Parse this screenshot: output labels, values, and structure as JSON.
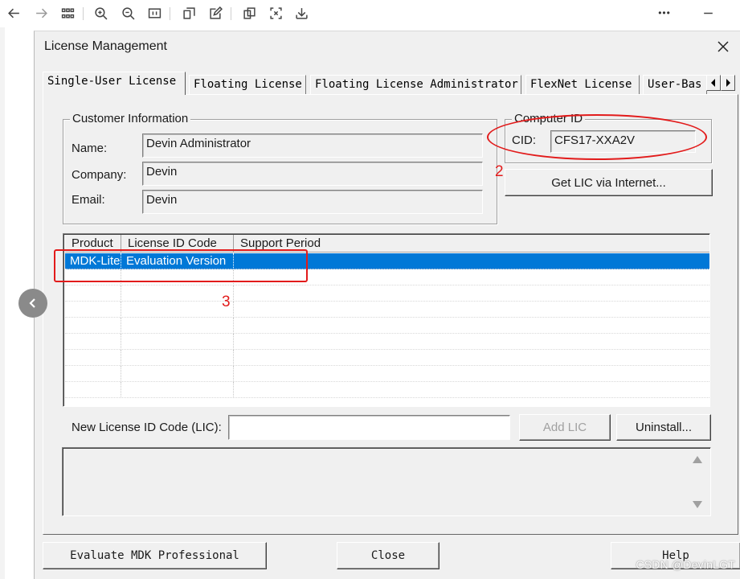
{
  "viewer": {
    "toolbar_icons": [
      "back-arrow-icon",
      "forward-arrow-icon",
      "grid-view-icon",
      "zoom-in-icon",
      "zoom-out-icon",
      "actual-size-icon",
      "crop-icon",
      "edit-icon",
      "copy-icon",
      "fullscreen-icon",
      "download-icon",
      "more-icon",
      "minimize-icon"
    ],
    "more_label": "•••"
  },
  "dialog": {
    "title": "License Management",
    "tabs": [
      "Single-User License",
      "Floating License",
      "Floating License Administrator",
      "FlexNet License",
      "User-Bas"
    ],
    "active_tab": "Single-User License",
    "customer": {
      "legend": "Customer Information",
      "name_label": "Name:",
      "name_value": "Devin Administrator",
      "company_label": "Company:",
      "company_value": "Devin",
      "email_label": "Email:",
      "email_value": "Devin"
    },
    "computer": {
      "legend": "Computer ID",
      "cid_label": "CID:",
      "cid_value": "CFS17-XXA2V",
      "get_lic_button": "Get LIC via Internet..."
    },
    "license_list": {
      "columns": [
        "Product",
        "License ID Code",
        "Support Period"
      ],
      "rows": [
        {
          "product": "MDK-Lite",
          "license_id": "Evaluation Version",
          "support_period": "",
          "selected": true
        }
      ]
    },
    "new_lic_label": "New License ID Code (LIC):",
    "new_lic_value": "",
    "add_lic_button": "Add LIC",
    "uninstall_button": "Uninstall...",
    "footer": {
      "evaluate_button": "Evaluate MDK Professional",
      "close_button": "Close",
      "help_button": "Help"
    }
  },
  "annotations": {
    "label_2": "2",
    "label_3": "3",
    "color": "#e21b1b"
  },
  "watermark": "CSDN @DevinLGT",
  "colors": {
    "selection": "#0078d7",
    "dialog_bg": "#f0f0f0"
  }
}
